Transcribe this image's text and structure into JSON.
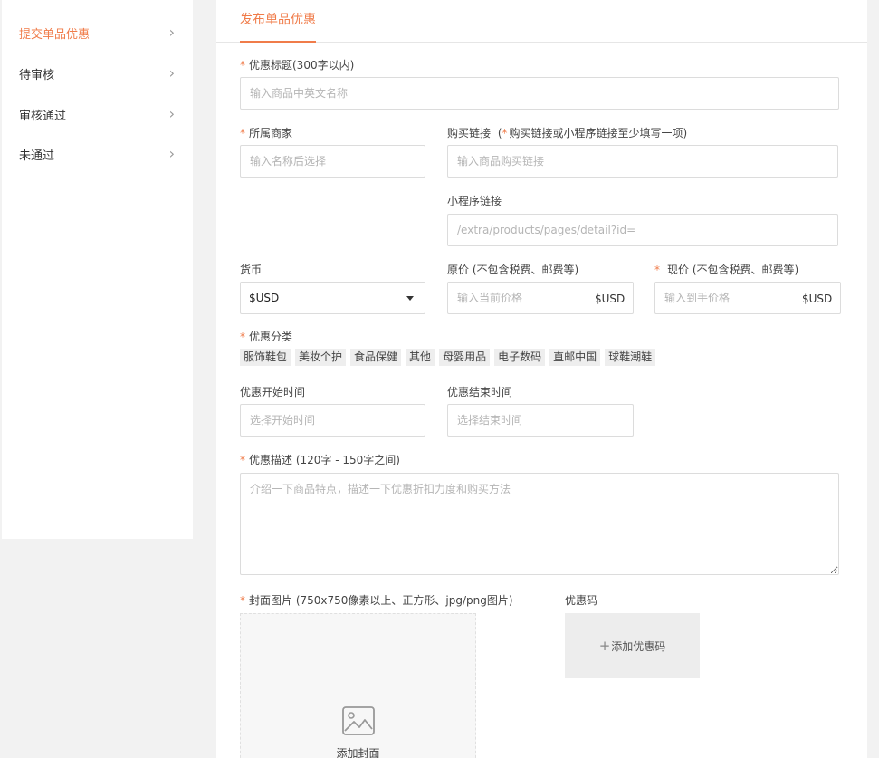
{
  "sidebar": {
    "items": [
      {
        "label": "提交单品优惠",
        "active": true
      },
      {
        "label": "待审核"
      },
      {
        "label": "审核通过"
      },
      {
        "label": "未通过"
      }
    ],
    "chevron": "›"
  },
  "tab": {
    "label": "发布单品优惠"
  },
  "form": {
    "required_mark": "*",
    "title": {
      "label": "优惠标题(300字以内)",
      "placeholder": "输入商品中英文名称"
    },
    "merchant": {
      "label": "所属商家",
      "placeholder": "输入名称后选择"
    },
    "buy_link": {
      "label": "购买链接",
      "note_open": "(",
      "note": "购买链接或小程序链接至少填写一项)",
      "placeholder": "输入商品购买链接"
    },
    "mini_link": {
      "label": "小程序链接",
      "placeholder": "/extra/products/pages/detail?id="
    },
    "currency": {
      "label": "货币",
      "value": "$USD"
    },
    "orig_price": {
      "label": "原价 (不包含税费、邮费等)",
      "placeholder": "输入当前价格",
      "suffix": "$USD"
    },
    "now_price": {
      "label": "现价 (不包含税费、邮费等)",
      "placeholder": "输入到手价格",
      "suffix": "$USD"
    },
    "category": {
      "label": "优惠分类",
      "tags": [
        "服饰鞋包",
        "美妆个护",
        "食品保健",
        "其他",
        "母婴用品",
        "电子数码",
        "直邮中国",
        "球鞋潮鞋"
      ]
    },
    "start_time": {
      "label": "优惠开始时间",
      "placeholder": "选择开始时间"
    },
    "end_time": {
      "label": "优惠结束时间",
      "placeholder": "选择结束时间"
    },
    "description": {
      "label": "优惠描述 (120字 - 150字之间)",
      "placeholder": "介绍一下商品特点，描述一下优惠折扣力度和购买方法"
    },
    "cover": {
      "label": "封面图片 (750x750像素以上、正方形、jpg/png图片)",
      "button": "添加封面",
      "icon": "image-icon"
    },
    "coupon": {
      "label": "优惠码",
      "plus": "+",
      "button": "添加优惠码"
    }
  },
  "colors": {
    "accent": "#f07c4a",
    "border": "#dcdcdc",
    "tag_bg": "#eeeeee"
  }
}
